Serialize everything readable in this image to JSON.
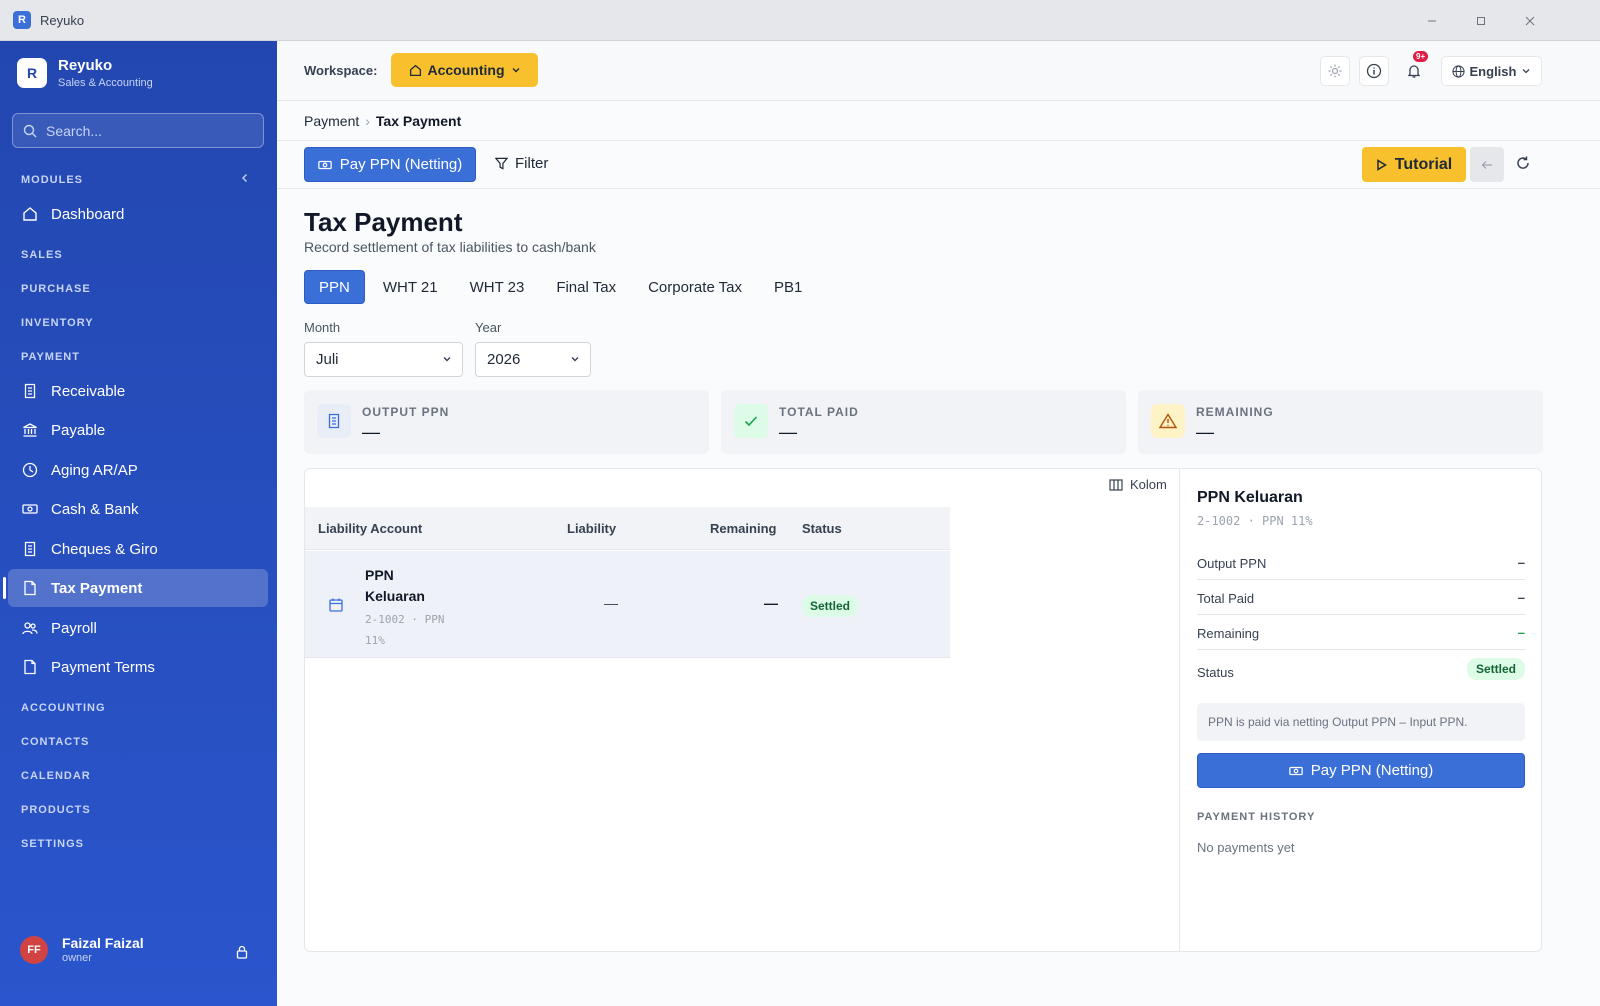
{
  "window": {
    "title": "Reyuko",
    "app_icon": "R"
  },
  "sidebar": {
    "brand": {
      "logo": "R",
      "name": "Reyuko",
      "subtitle": "Sales & Accounting"
    },
    "search_placeholder": "Search...",
    "sections": {
      "modules": "MODULES",
      "sales": "SALES",
      "purchase": "PURCHASE",
      "inventory": "INVENTORY",
      "payment": "PAYMENT",
      "accounting": "ACCOUNTING",
      "contacts": "CONTACTS",
      "calendar": "CALENDAR",
      "products": "PRODUCTS",
      "settings": "SETTINGS"
    },
    "items": {
      "dashboard": "Dashboard",
      "receivable": "Receivable",
      "payable": "Payable",
      "aging": "Aging AR/AP",
      "cash_bank": "Cash & Bank",
      "cheques": "Cheques & Giro",
      "tax_payment": "Tax Payment",
      "payroll": "Payroll",
      "payment_terms": "Payment Terms"
    },
    "user": {
      "initials": "FF",
      "name": "Faizal Faizal",
      "role": "owner"
    }
  },
  "topbar": {
    "workspace_label": "Workspace:",
    "workspace_value": "Accounting",
    "notification_badge": "9+",
    "language": "English"
  },
  "breadcrumb": {
    "parent": "Payment",
    "separator": "›",
    "current": "Tax Payment"
  },
  "actions": {
    "pay_button": "Pay PPN (Netting)",
    "filter": "Filter",
    "tutorial": "Tutorial"
  },
  "page": {
    "title": "Tax Payment",
    "subtitle": "Record settlement of tax liabilities to cash/bank",
    "tabs": [
      "PPN",
      "WHT 21",
      "WHT 23",
      "Final Tax",
      "Corporate Tax",
      "PB1"
    ],
    "active_tab": "PPN",
    "month_label": "Month",
    "month_value": "Juli",
    "year_label": "Year",
    "year_value": "2026"
  },
  "summary": {
    "output": {
      "label": "OUTPUT PPN",
      "value": "—"
    },
    "paid": {
      "label": "TOTAL PAID",
      "value": "—"
    },
    "remaining": {
      "label": "REMAINING",
      "value": "—"
    }
  },
  "table": {
    "columns_button": "Kolom",
    "headers": {
      "account": "Liability Account",
      "liability": "Liability",
      "remaining": "Remaining",
      "status": "Status"
    },
    "rows": [
      {
        "name_line1": "PPN",
        "name_line2": "Keluaran",
        "code_line1": "2-1002 · PPN",
        "code_line2": "11%",
        "liability": "—",
        "remaining": "—",
        "status": "Settled"
      }
    ]
  },
  "detail": {
    "name": "PPN Keluaran",
    "code": "2-1002 · PPN 11%",
    "output_label": "Output PPN",
    "output_value": "–",
    "paid_label": "Total Paid",
    "paid_value": "–",
    "remaining_label": "Remaining",
    "remaining_value": "–",
    "status_label": "Status",
    "status_value": "Settled",
    "note": "PPN is paid via netting Output PPN – Input PPN.",
    "pay_button": "Pay PPN (Netting)",
    "history_title": "PAYMENT HISTORY",
    "history_empty": "No payments yet"
  },
  "colors": {
    "primary": "#3b6fd8",
    "sidebar": "#2347b0",
    "accent": "#f9c02e",
    "success": "#166534"
  }
}
